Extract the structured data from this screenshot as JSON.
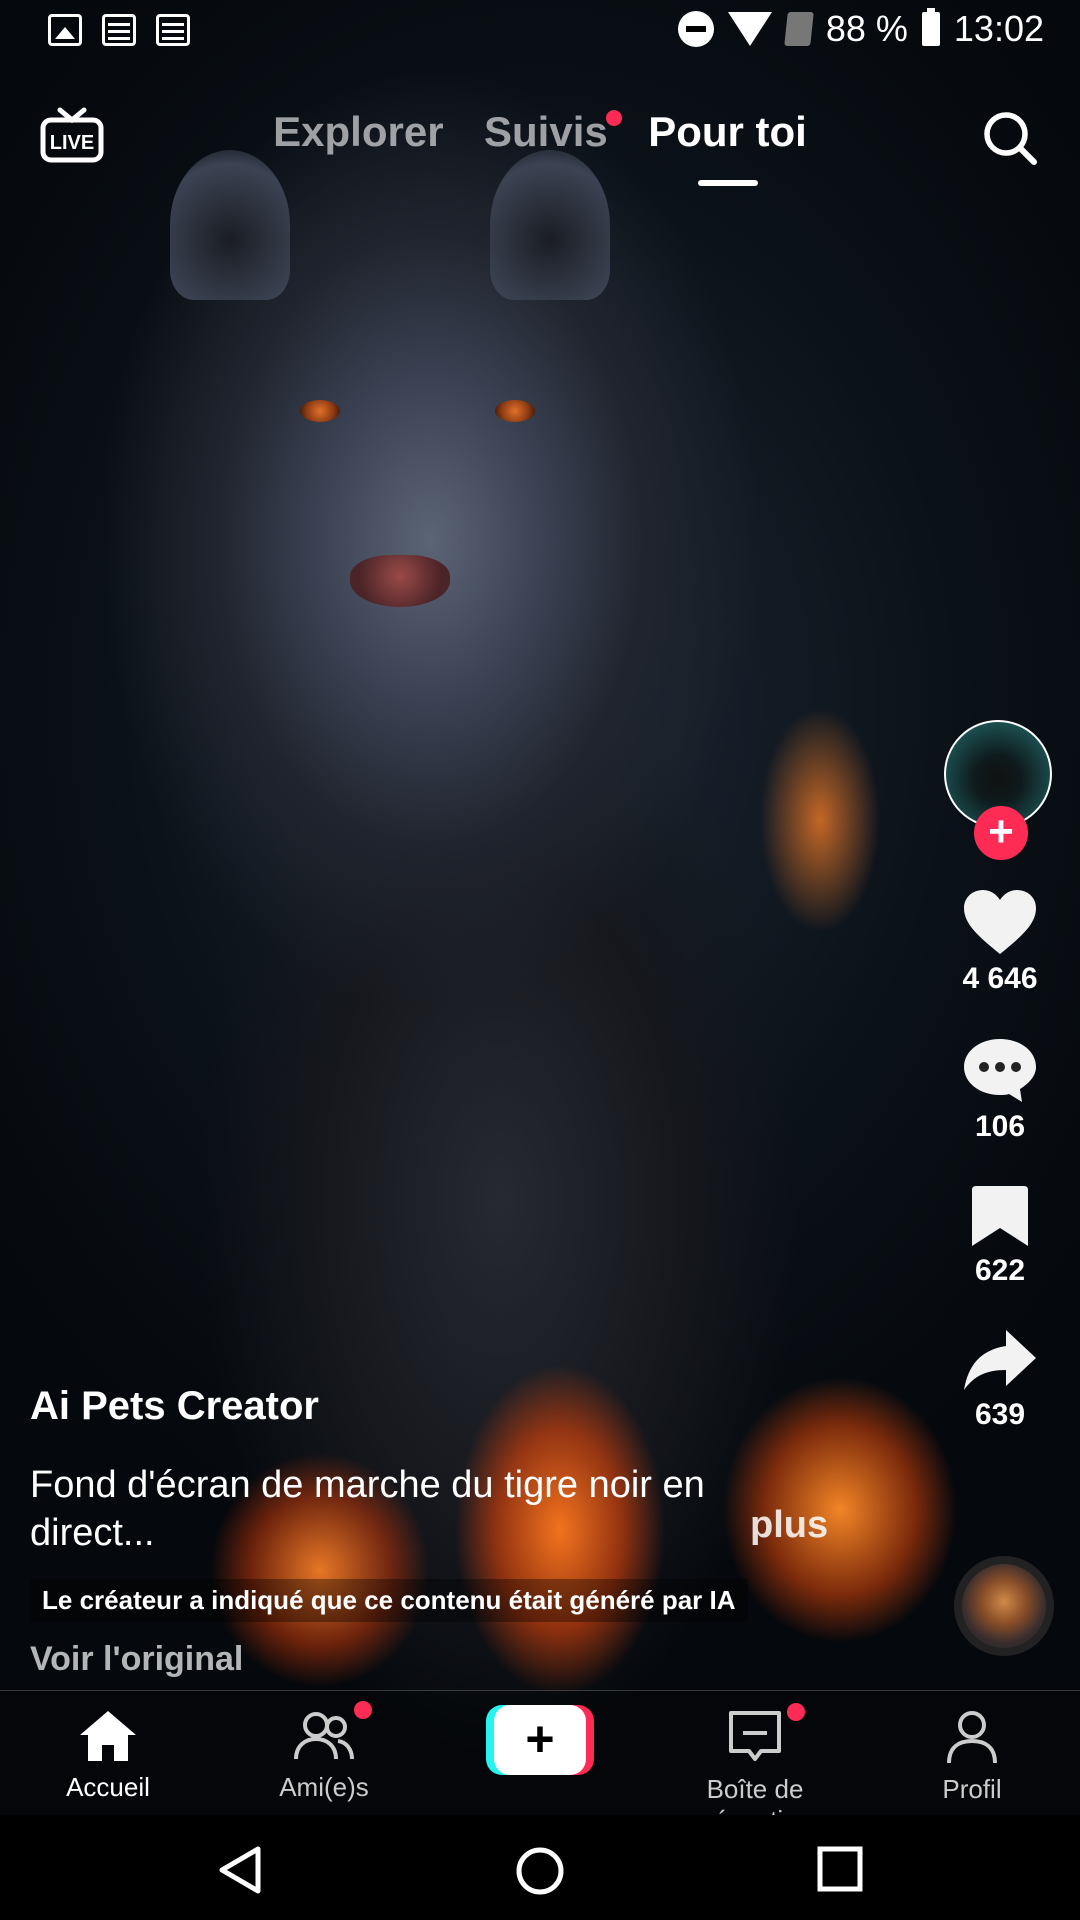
{
  "status_bar": {
    "battery_percent": "88 %",
    "time": "13:02",
    "left_icons": [
      "image-notification-icon",
      "news-notification-icon",
      "news-notification-icon"
    ],
    "right_icons": [
      "do-not-disturb-icon",
      "wifi-icon",
      "no-sim-icon",
      "battery-icon"
    ]
  },
  "top_nav": {
    "live_label": "LIVE",
    "tabs": [
      {
        "label": "Explorer",
        "active": false
      },
      {
        "label": "Suivis",
        "active": false,
        "has_dot": true
      },
      {
        "label": "Pour toi",
        "active": true
      }
    ]
  },
  "actions": {
    "likes": "4 646",
    "comments": "106",
    "bookmarks": "622",
    "shares": "639"
  },
  "caption": {
    "creator": "Ai Pets Creator",
    "description": "Fond d'écran de marche du tigre noir en direct...",
    "more": "plus",
    "ai_label": "Le créateur a indiqué que ce contenu était généré par IA",
    "original_link": "Voir l'original"
  },
  "bottom_nav": {
    "items": [
      {
        "label": "Accueil",
        "active": true
      },
      {
        "label": "Ami(e)s",
        "has_dot": true
      },
      {
        "label": "",
        "type": "create"
      },
      {
        "label": "Boîte de récepti...",
        "has_dot": true
      },
      {
        "label": "Profil"
      }
    ]
  },
  "colors": {
    "accent_red": "#fe2c55",
    "accent_cyan": "#25f4ee",
    "background": "#000000"
  }
}
